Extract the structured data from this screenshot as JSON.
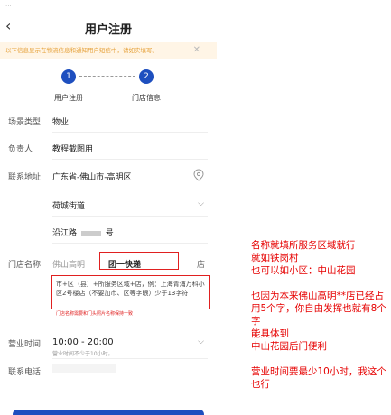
{
  "header": {
    "back_icon": "chevron-left-icon",
    "title": "用户注册"
  },
  "notice": {
    "text": "以下信息显示在物流信息和通知用户短信中，请如实填写。",
    "close": "✕"
  },
  "steps": [
    {
      "num": "1",
      "label": "用户注册"
    },
    {
      "num": "2",
      "label": "门店信息"
    }
  ],
  "form": {
    "scene": {
      "label": "场景类型",
      "value": "物业"
    },
    "owner": {
      "label": "负责人",
      "value": "教程截图用"
    },
    "address": {
      "label": "联系地址",
      "value": "广东省-佛山市-高明区",
      "street": "荷城街道",
      "road": "沿江路",
      "road_suffix": "号"
    },
    "store": {
      "label": "门店名称",
      "prefix": "佛山高明",
      "name": "团一快递",
      "suffix": "店",
      "hint": "市+区（县）+所服务区域+店，例：上海青浦万科小区2号楼店（不要加市、区等字眼）少于13字符",
      "note": "门店名称需要和门头照片名称保持一致"
    },
    "hours": {
      "label": "营业时间",
      "value": "10:00 - 20:00",
      "sub": "营业时间不少于10小时。"
    },
    "phone": {
      "label": "联系电话"
    }
  },
  "annotation": {
    "line1": "名称就填所服务区域就行",
    "line2": "就如铁岗村",
    "line3": "也可以如小区：中山花园",
    "line4": "也因为本来佛山高明**店已经占用5个字，你自由发挥也就有8个字",
    "line5": "能具体到",
    "line6": "中山花园后门便利",
    "line7": "营业时间要最少10小时，我这个也行"
  }
}
